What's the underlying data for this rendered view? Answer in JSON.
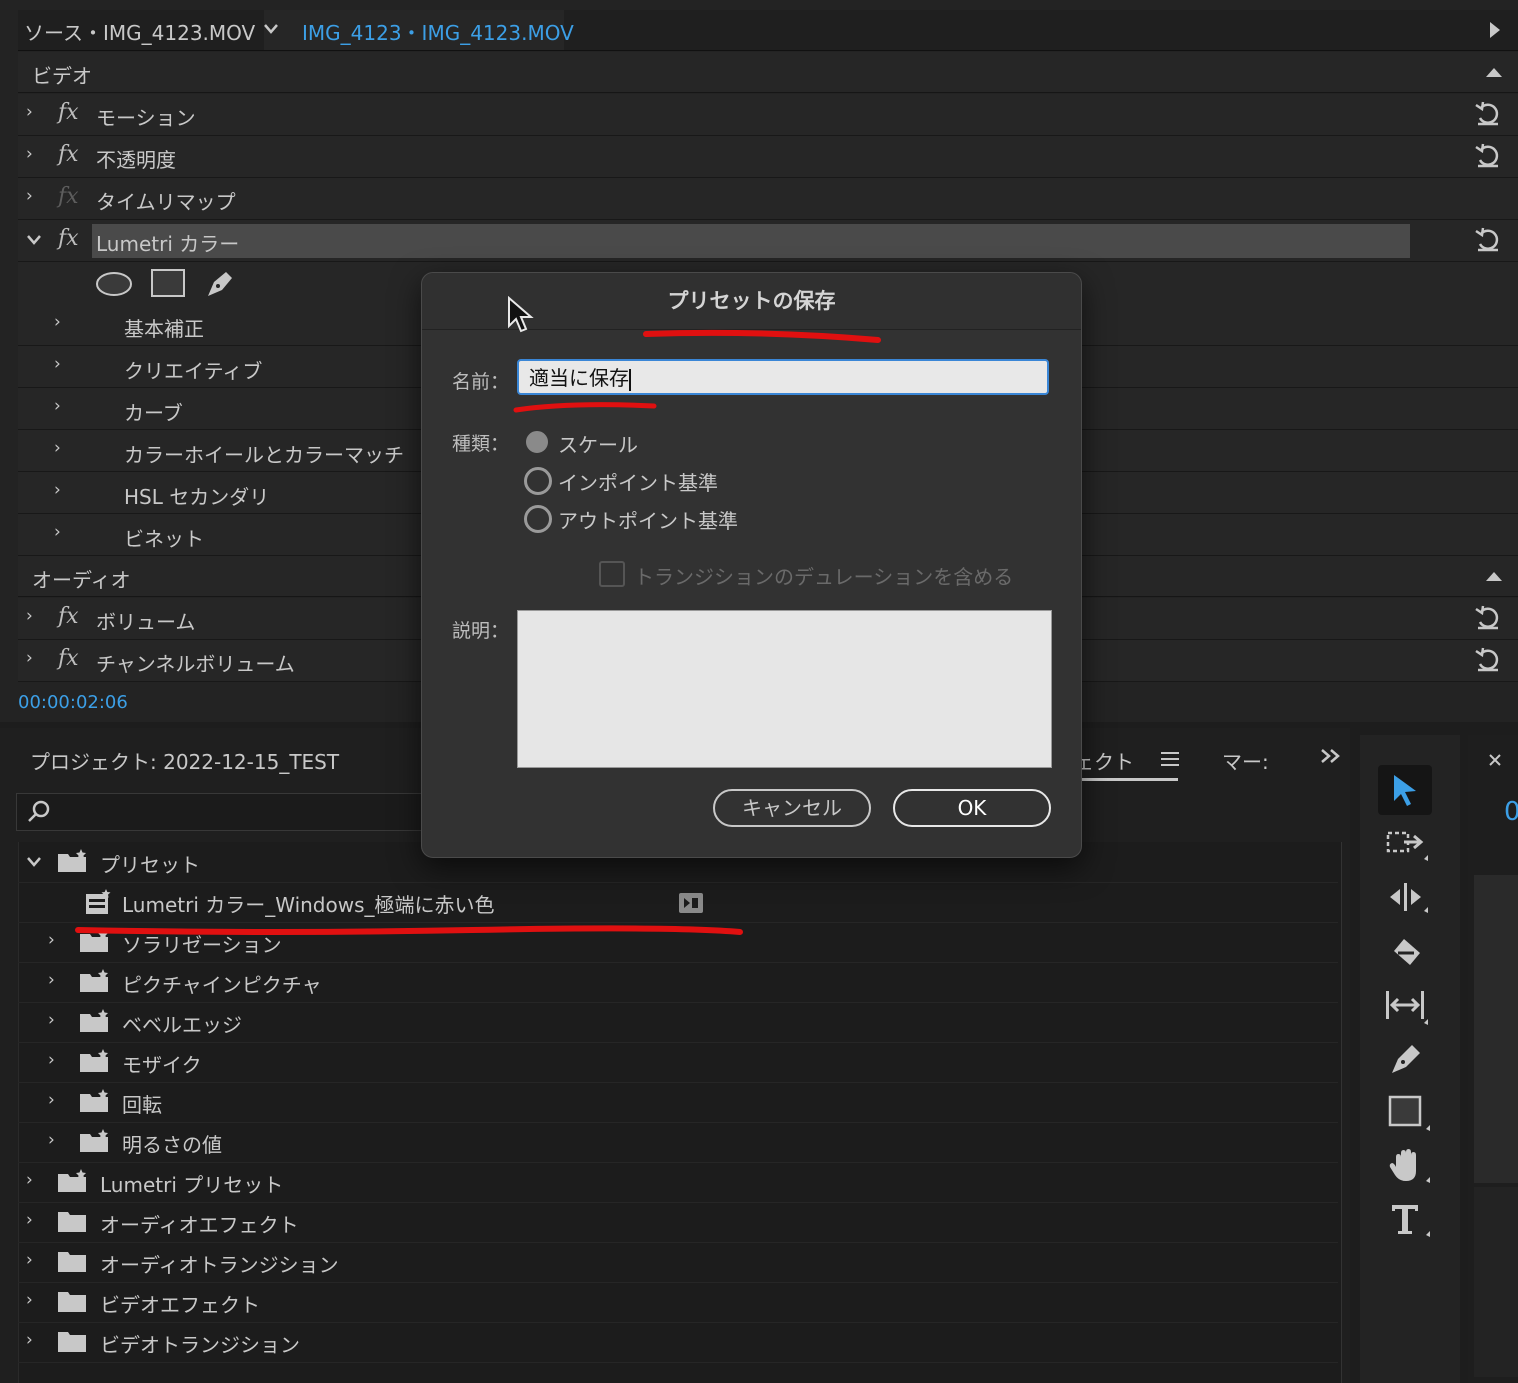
{
  "source_tab": {
    "label": "ソース・IMG_4123.MOV",
    "clip_label": "IMG_4123・IMG_4123.MOV"
  },
  "effect_controls": {
    "video_header": "ビデオ",
    "motion": "モーション",
    "opacity": "不透明度",
    "time_remap": "タイムリマップ",
    "lumetri": "Lumetri カラー",
    "lumetri_sub": [
      "基本補正",
      "クリエイティブ",
      "カーブ",
      "カラーホイールとカラーマッチ",
      "HSL セカンダリ",
      "ビネット"
    ],
    "audio_header": "オーディオ",
    "volume": "ボリューム",
    "channel_volume": "チャンネルボリューム",
    "timecode": "00:00:02:06"
  },
  "project_panel": {
    "title": "プロジェクト: 2022-12-15_TEST",
    "tab_effects_partial": "ェクト",
    "tab_markers_partial": "マー:"
  },
  "tree": {
    "presets": "プリセット",
    "saved_preset": "Lumetri カラー_Windows_極端に赤い色",
    "solarization": "ソラリゼーション",
    "pip": "ピクチャインピクチャ",
    "bevel": "ベベルエッジ",
    "mosaic": "モザイク",
    "rotate": "回転",
    "brightness": "明るさの値",
    "lumetri_presets": "Lumetri プリセット",
    "audio_effects": "オーディオエフェクト",
    "audio_transitions": "オーディオトランジション",
    "video_effects": "ビデオエフェクト",
    "video_transitions": "ビデオトランジション"
  },
  "dialog": {
    "title": "プリセットの保存",
    "name_label": "名前：",
    "name_value": "適当に保存",
    "type_label": "種類：",
    "type_options": [
      "スケール",
      "インポイント基準",
      "アウトポイント基準"
    ],
    "selected_type": "スケール",
    "include_transition_label": "トランジションのデュレーションを含める",
    "include_transition_checked": false,
    "description_label": "説明：",
    "description_value": "",
    "cancel_label": "キャンセル",
    "ok_label": "OK"
  },
  "colors": {
    "accent_blue": "#3c9fe6",
    "annotation_red": "#e01010"
  },
  "right_panel_partial": "0"
}
